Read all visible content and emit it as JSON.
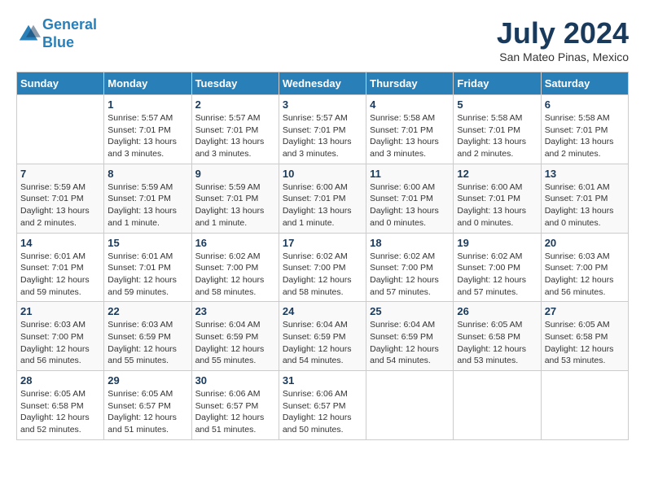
{
  "logo": {
    "line1": "General",
    "line2": "Blue"
  },
  "title": "July 2024",
  "location": "San Mateo Pinas, Mexico",
  "days_header": [
    "Sunday",
    "Monday",
    "Tuesday",
    "Wednesday",
    "Thursday",
    "Friday",
    "Saturday"
  ],
  "weeks": [
    [
      {
        "num": "",
        "info": ""
      },
      {
        "num": "1",
        "info": "Sunrise: 5:57 AM\nSunset: 7:01 PM\nDaylight: 13 hours\nand 3 minutes."
      },
      {
        "num": "2",
        "info": "Sunrise: 5:57 AM\nSunset: 7:01 PM\nDaylight: 13 hours\nand 3 minutes."
      },
      {
        "num": "3",
        "info": "Sunrise: 5:57 AM\nSunset: 7:01 PM\nDaylight: 13 hours\nand 3 minutes."
      },
      {
        "num": "4",
        "info": "Sunrise: 5:58 AM\nSunset: 7:01 PM\nDaylight: 13 hours\nand 3 minutes."
      },
      {
        "num": "5",
        "info": "Sunrise: 5:58 AM\nSunset: 7:01 PM\nDaylight: 13 hours\nand 2 minutes."
      },
      {
        "num": "6",
        "info": "Sunrise: 5:58 AM\nSunset: 7:01 PM\nDaylight: 13 hours\nand 2 minutes."
      }
    ],
    [
      {
        "num": "7",
        "info": "Sunrise: 5:59 AM\nSunset: 7:01 PM\nDaylight: 13 hours\nand 2 minutes."
      },
      {
        "num": "8",
        "info": "Sunrise: 5:59 AM\nSunset: 7:01 PM\nDaylight: 13 hours\nand 1 minute."
      },
      {
        "num": "9",
        "info": "Sunrise: 5:59 AM\nSunset: 7:01 PM\nDaylight: 13 hours\nand 1 minute."
      },
      {
        "num": "10",
        "info": "Sunrise: 6:00 AM\nSunset: 7:01 PM\nDaylight: 13 hours\nand 1 minute."
      },
      {
        "num": "11",
        "info": "Sunrise: 6:00 AM\nSunset: 7:01 PM\nDaylight: 13 hours\nand 0 minutes."
      },
      {
        "num": "12",
        "info": "Sunrise: 6:00 AM\nSunset: 7:01 PM\nDaylight: 13 hours\nand 0 minutes."
      },
      {
        "num": "13",
        "info": "Sunrise: 6:01 AM\nSunset: 7:01 PM\nDaylight: 13 hours\nand 0 minutes."
      }
    ],
    [
      {
        "num": "14",
        "info": "Sunrise: 6:01 AM\nSunset: 7:01 PM\nDaylight: 12 hours\nand 59 minutes."
      },
      {
        "num": "15",
        "info": "Sunrise: 6:01 AM\nSunset: 7:01 PM\nDaylight: 12 hours\nand 59 minutes."
      },
      {
        "num": "16",
        "info": "Sunrise: 6:02 AM\nSunset: 7:00 PM\nDaylight: 12 hours\nand 58 minutes."
      },
      {
        "num": "17",
        "info": "Sunrise: 6:02 AM\nSunset: 7:00 PM\nDaylight: 12 hours\nand 58 minutes."
      },
      {
        "num": "18",
        "info": "Sunrise: 6:02 AM\nSunset: 7:00 PM\nDaylight: 12 hours\nand 57 minutes."
      },
      {
        "num": "19",
        "info": "Sunrise: 6:02 AM\nSunset: 7:00 PM\nDaylight: 12 hours\nand 57 minutes."
      },
      {
        "num": "20",
        "info": "Sunrise: 6:03 AM\nSunset: 7:00 PM\nDaylight: 12 hours\nand 56 minutes."
      }
    ],
    [
      {
        "num": "21",
        "info": "Sunrise: 6:03 AM\nSunset: 7:00 PM\nDaylight: 12 hours\nand 56 minutes."
      },
      {
        "num": "22",
        "info": "Sunrise: 6:03 AM\nSunset: 6:59 PM\nDaylight: 12 hours\nand 55 minutes."
      },
      {
        "num": "23",
        "info": "Sunrise: 6:04 AM\nSunset: 6:59 PM\nDaylight: 12 hours\nand 55 minutes."
      },
      {
        "num": "24",
        "info": "Sunrise: 6:04 AM\nSunset: 6:59 PM\nDaylight: 12 hours\nand 54 minutes."
      },
      {
        "num": "25",
        "info": "Sunrise: 6:04 AM\nSunset: 6:59 PM\nDaylight: 12 hours\nand 54 minutes."
      },
      {
        "num": "26",
        "info": "Sunrise: 6:05 AM\nSunset: 6:58 PM\nDaylight: 12 hours\nand 53 minutes."
      },
      {
        "num": "27",
        "info": "Sunrise: 6:05 AM\nSunset: 6:58 PM\nDaylight: 12 hours\nand 53 minutes."
      }
    ],
    [
      {
        "num": "28",
        "info": "Sunrise: 6:05 AM\nSunset: 6:58 PM\nDaylight: 12 hours\nand 52 minutes."
      },
      {
        "num": "29",
        "info": "Sunrise: 6:05 AM\nSunset: 6:57 PM\nDaylight: 12 hours\nand 51 minutes."
      },
      {
        "num": "30",
        "info": "Sunrise: 6:06 AM\nSunset: 6:57 PM\nDaylight: 12 hours\nand 51 minutes."
      },
      {
        "num": "31",
        "info": "Sunrise: 6:06 AM\nSunset: 6:57 PM\nDaylight: 12 hours\nand 50 minutes."
      },
      {
        "num": "",
        "info": ""
      },
      {
        "num": "",
        "info": ""
      },
      {
        "num": "",
        "info": ""
      }
    ]
  ]
}
